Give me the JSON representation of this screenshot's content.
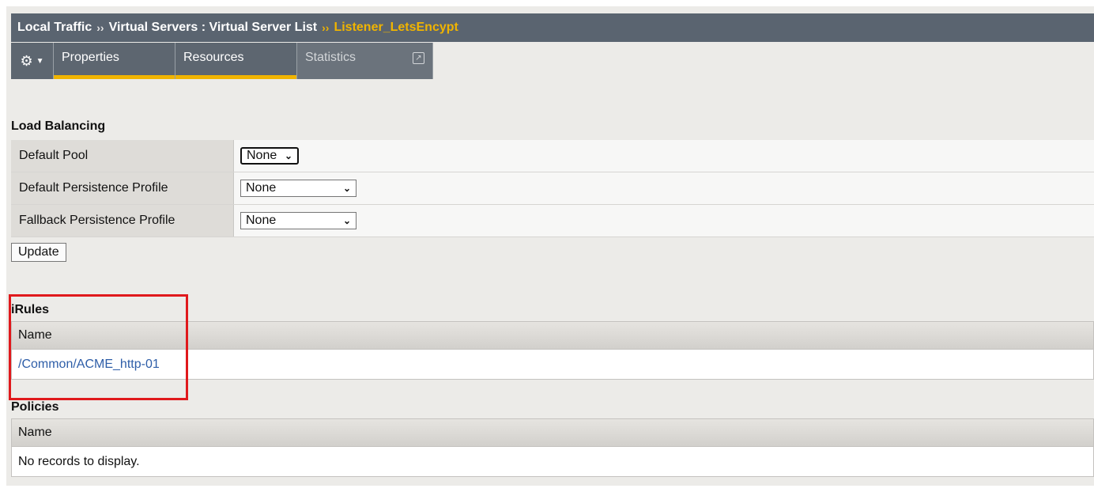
{
  "breadcrumb": {
    "items": [
      "Local Traffic",
      "Virtual Servers : Virtual Server List"
    ],
    "separator": "››",
    "current": "Listener_LetsEncypt"
  },
  "tabs": [
    {
      "label": "Properties",
      "state": "active"
    },
    {
      "label": "Resources",
      "state": "selected"
    },
    {
      "label": "Statistics",
      "state": "disabled"
    }
  ],
  "load_balancing": {
    "title": "Load Balancing",
    "rows": [
      {
        "label": "Default Pool",
        "value": "None"
      },
      {
        "label": "Default Persistence Profile",
        "value": "None"
      },
      {
        "label": "Fallback Persistence Profile",
        "value": "None"
      }
    ],
    "update_label": "Update"
  },
  "irules": {
    "title": "iRules",
    "column": "Name",
    "rows": [
      "/Common/ACME_http-01"
    ]
  },
  "policies": {
    "title": "Policies",
    "column": "Name",
    "empty": "No records to display."
  },
  "colors": {
    "accent": "#f0b400",
    "header": "#5a6470",
    "link": "#2e5ea8",
    "highlight": "#e0191c"
  },
  "icons": {
    "settings": "gear-icon",
    "dropdown": "chevron-down-icon",
    "external": "external-link-icon"
  }
}
